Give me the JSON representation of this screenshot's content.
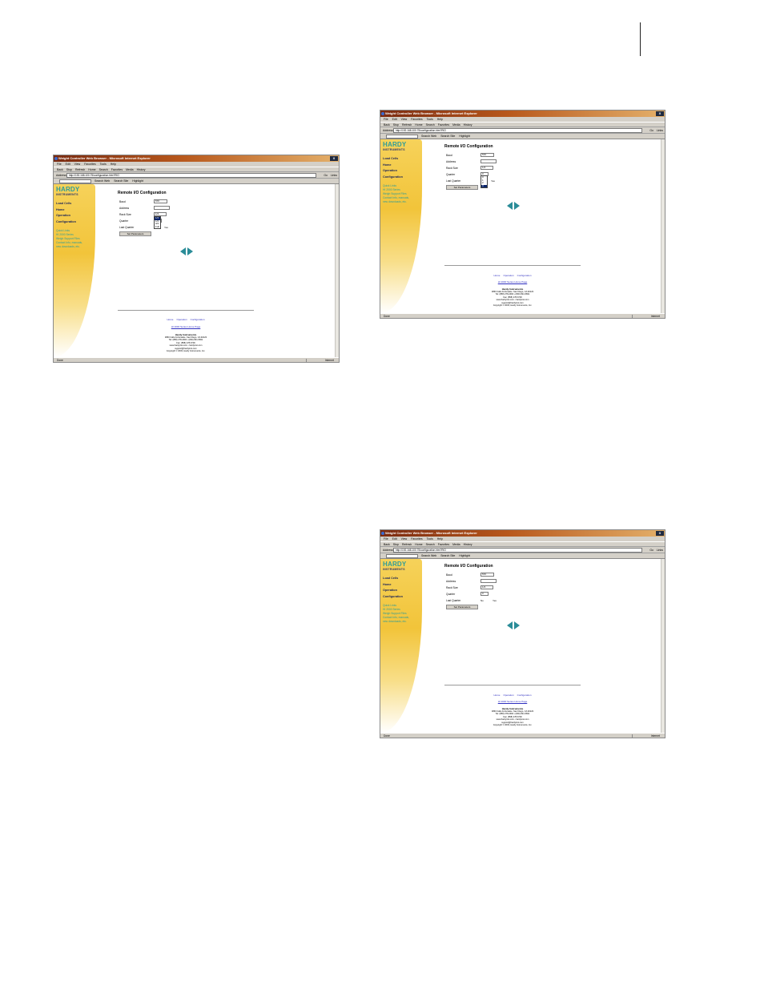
{
  "browser": {
    "title": "Weight Controller Web Browser - Microsoft Internet Explorer",
    "close": "X",
    "menu": [
      "File",
      "Edit",
      "View",
      "Favorites",
      "Tools",
      "Help"
    ],
    "toolbar": [
      "Back",
      "Stop",
      "Refresh",
      "Home",
      "Search",
      "Favorites",
      "Media",
      "History"
    ],
    "address_label": "Address",
    "address_value": "http://192.168.100.75/configuration.htm?RIO",
    "go": "Go",
    "links": "Links",
    "links_bar": [
      "Search Web",
      "Search Site",
      "Highlight"
    ],
    "status_left": "Done",
    "status_right": "Internet"
  },
  "sidebar": {
    "logo_brand": "HARDY",
    "logo_sub": "INSTRUMENTS",
    "nav": [
      "Load Cells",
      "Home",
      "Operation",
      "Configuration"
    ],
    "quick_links": [
      "Quick Links",
      "HI 2000 Series",
      "Weigh Support Files",
      "Contact Info, manuals,",
      "new downloads, etc."
    ]
  },
  "config": {
    "heading": "Remote I/O Configuration",
    "fields": [
      {
        "label": "Baud",
        "value": "57K"
      },
      {
        "label": "Address",
        "value": ""
      },
      {
        "label": "Rack Size",
        "value": "1/4"
      },
      {
        "label": "Quarter",
        "value": "0"
      },
      {
        "label": "Last Quarter",
        "value": ""
      }
    ],
    "radio_no": "No",
    "radio_yes": "Yes",
    "button": "Set Parameters",
    "dropdown_rack": [
      "1/4",
      "1/2",
      "3/4",
      "Full"
    ],
    "dropdown_quarter": [
      "0",
      "1",
      "2",
      "3"
    ]
  },
  "footer": {
    "links": [
      "Home",
      "Operation",
      "Configuration"
    ],
    "series": "HI 2000 Series Home Page",
    "company": "Hardy Instruments",
    "lines": [
      "3860 Calle Fortunada • San Diego, CA 92123",
      "Tel: (858) 278-2900 • (800) 821-5831",
      "Fax: (858) 278-6700",
      "www.hardyinst.com • hardyinst.com",
      "support@hardyinst.com",
      "Copyright © 2003, Hardy Instruments, Inc."
    ]
  }
}
